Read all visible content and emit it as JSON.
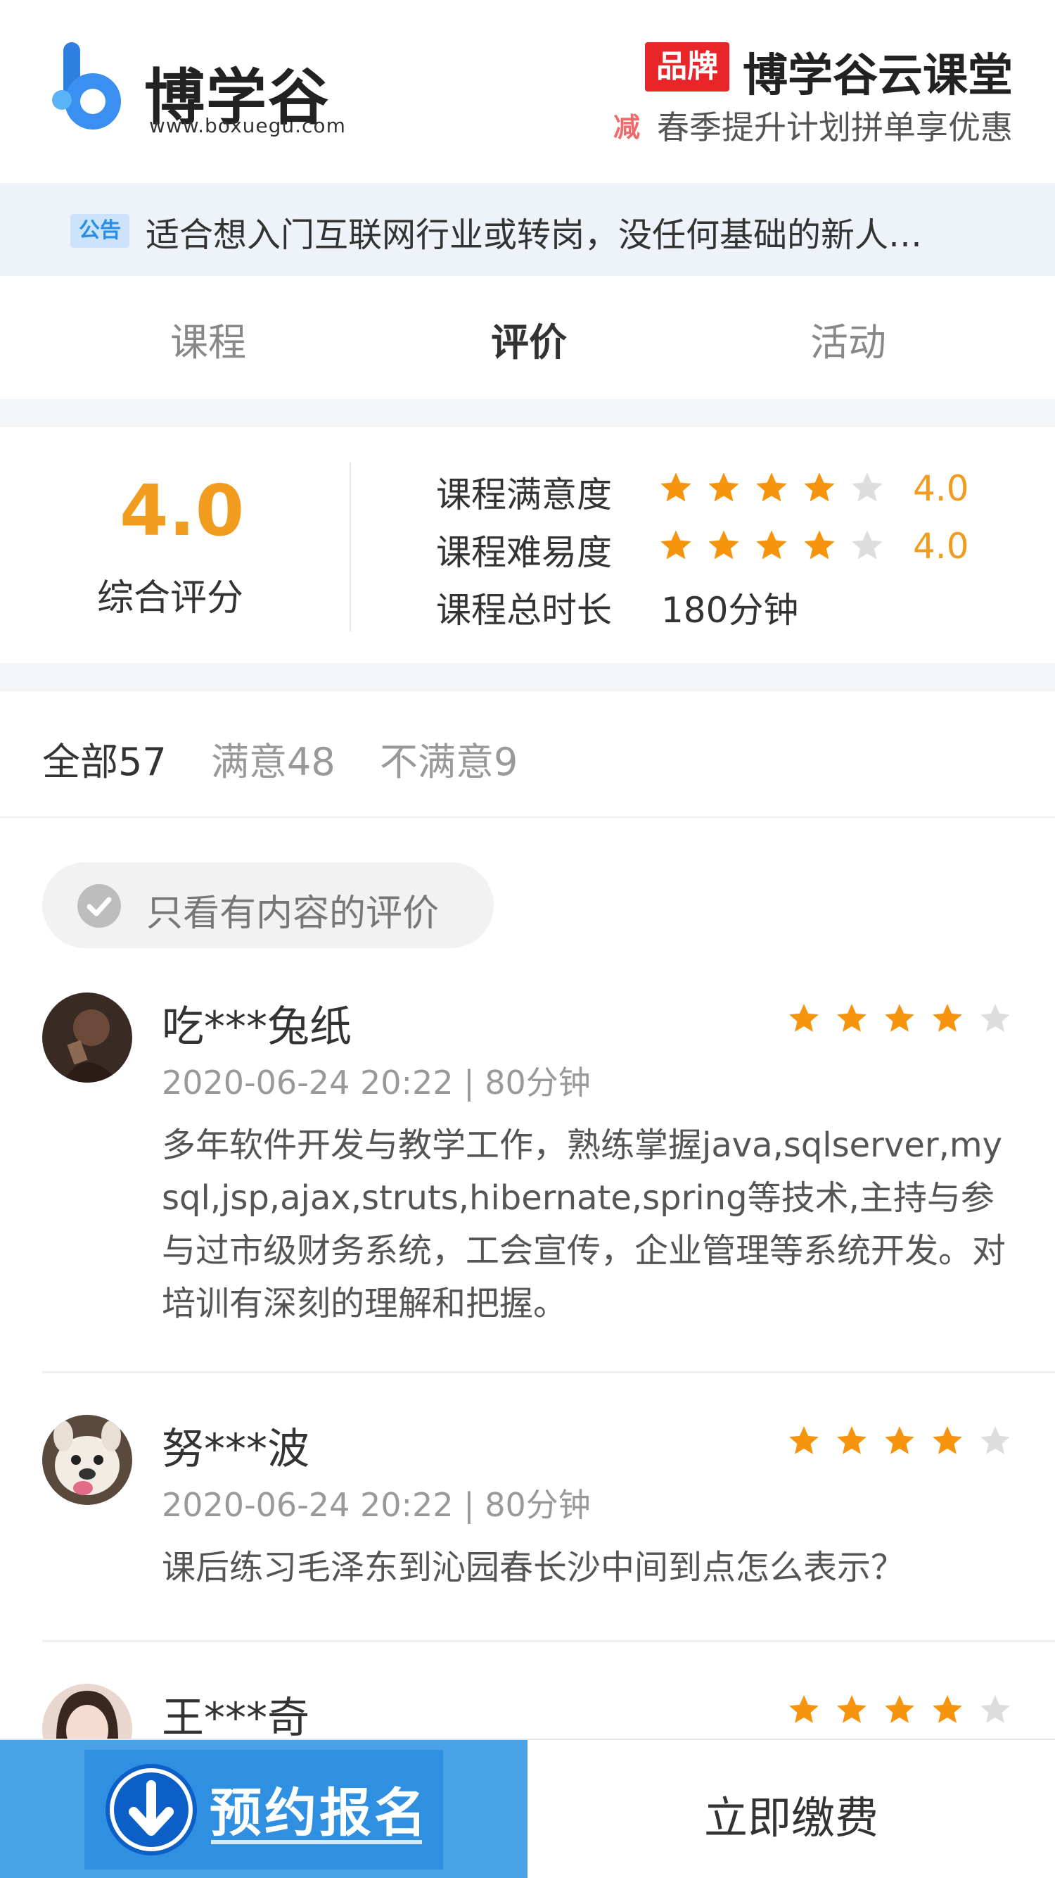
{
  "header": {
    "logo_text": "博学谷",
    "logo_url": "www.boxuegu.com",
    "brand_badge": "品牌",
    "brand_title": "博学谷云课堂",
    "promo_tag": "减",
    "promo_text": "春季提升计划拼单享优惠"
  },
  "notice": {
    "tag": "公告",
    "text": "适合想入门互联网行业或转岗，没任何基础的新人…"
  },
  "tabs": [
    {
      "label": "课程",
      "active": false
    },
    {
      "label": "评价",
      "active": true
    },
    {
      "label": "活动",
      "active": false
    }
  ],
  "score": {
    "value": "4.0",
    "label": "综合评分",
    "metrics": [
      {
        "label": "课程满意度",
        "rating": 4,
        "max": 5,
        "value": "4.0"
      },
      {
        "label": "课程难易度",
        "rating": 4,
        "max": 5,
        "value": "4.0"
      },
      {
        "label": "课程总时长",
        "text": "180分钟"
      }
    ]
  },
  "filters": [
    {
      "label": "全部57",
      "active": true
    },
    {
      "label": "满意48",
      "active": false
    },
    {
      "label": "不满意9",
      "active": false
    }
  ],
  "chip": {
    "label": "只看有内容的评价"
  },
  "reviews": [
    {
      "name": "吃***兔纸",
      "rating": 4,
      "meta": "2020-06-24 20:22 | 80分钟",
      "body": "多年软件开发与教学工作，熟练掌握java,sqlserver,mysql,jsp,ajax,struts,hibernate,spring等技术,主持与参与过市级财务系统，工会宣传，企业管理等系统开发。对培训有深刻的理解和把握。"
    },
    {
      "name": "努***波",
      "rating": 4,
      "meta": "2020-06-24 20:22 | 80分钟",
      "body": "课后练习毛泽东到沁园春长沙中间到点怎么表示？"
    },
    {
      "name": "王***奇",
      "rating": 4,
      "meta": "",
      "body": ""
    }
  ],
  "bottom": {
    "reserve_label": "预约报名",
    "pay_label": "立即缴费"
  },
  "colors": {
    "accent_orange": "#f29c1f",
    "star_active": "#f7940e",
    "star_inactive": "#dddddd",
    "brand_red": "#e8262a",
    "reserve_blue": "#4aa2e6"
  }
}
